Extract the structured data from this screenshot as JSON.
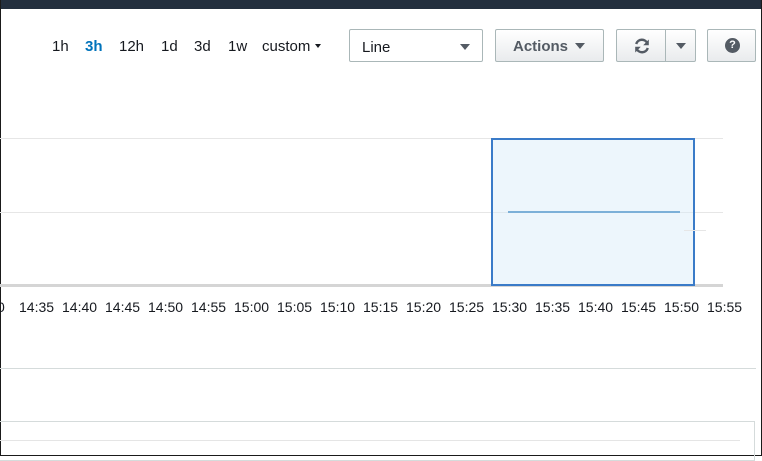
{
  "toolbar": {
    "time_ranges": [
      "1h",
      "3h",
      "12h",
      "1d",
      "3d",
      "1w"
    ],
    "active_range": "3h",
    "custom_label": "custom",
    "view_select": {
      "value": "Line"
    },
    "actions_label": "Actions",
    "refresh_icon": "refresh-icon",
    "help_icon": "help-icon",
    "help_glyph": "?"
  },
  "chart_data": {
    "type": "line",
    "x_tick_labels": [
      "0",
      "14:35",
      "14:40",
      "14:45",
      "14:50",
      "14:55",
      "15:00",
      "15:05",
      "15:10",
      "15:15",
      "15:20",
      "15:25",
      "15:30",
      "15:35",
      "15:40",
      "15:45",
      "15:50",
      "15:55"
    ],
    "series": [
      {
        "x": [
          "15:30",
          "15:50"
        ],
        "y": [
          1,
          1
        ]
      }
    ],
    "selection_range": [
      "15:28",
      "15:51"
    ],
    "grid": true,
    "colors": {
      "line": "#7cb0d8",
      "selection_border": "#3a7bc8",
      "selection_fill": "#eaf4fb"
    }
  }
}
